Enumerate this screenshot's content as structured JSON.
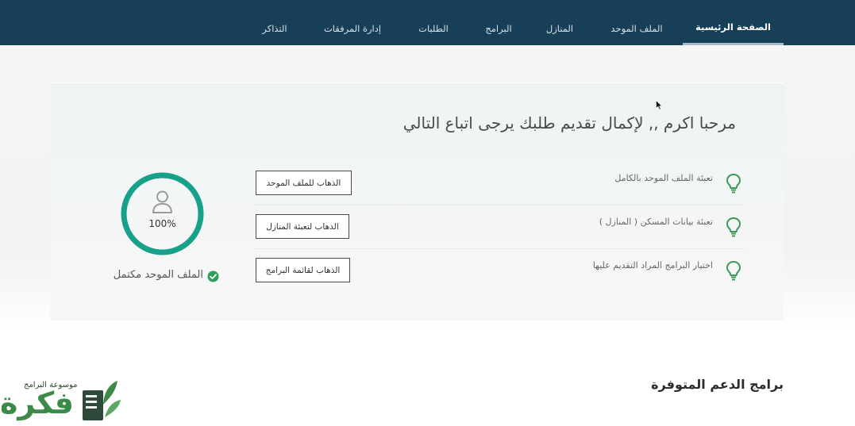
{
  "nav": {
    "items": [
      {
        "label": "الصفحة الرئيسية",
        "active": true
      },
      {
        "label": "الملف الموحد"
      },
      {
        "label": "المنازل"
      },
      {
        "label": "البرامج"
      },
      {
        "label": "الطلبات"
      },
      {
        "label": "إدارة المرفقات"
      },
      {
        "label": "التذاكر"
      }
    ]
  },
  "welcome": "مرحبا اكرم ,, لإكمال تقديم طلبك يرجى اتباع التالي",
  "steps": [
    {
      "label": "تعبئة الملف الموحد بالكامل",
      "button": "الذهاب للملف الموحد",
      "icon": "lightbulb-icon"
    },
    {
      "label": "تعبئة بيانات المسكن ( المنازل )",
      "button": "الذهاب لتعبئة المنازل",
      "icon": "lightbulb-icon"
    },
    {
      "label": "اختيار البرامج المراد التقديم عليها",
      "button": "الذهاب لقائمة البرامج",
      "icon": "lightbulb-icon"
    }
  ],
  "profile": {
    "progress_text": "100%",
    "progress_fraction": 1.0,
    "status_label": "الملف الموحد مكتمل",
    "icon": "user-icon"
  },
  "section_title": "برامج الدعم المتوفرة",
  "logo": {
    "tagline": "موسوعة البرامج",
    "word": "فكرة"
  },
  "colors": {
    "nav_bg": "#173f58",
    "accent_teal": "#17a08a",
    "success_green": "#2f9e58",
    "bulb_green": "#3e9a54"
  }
}
